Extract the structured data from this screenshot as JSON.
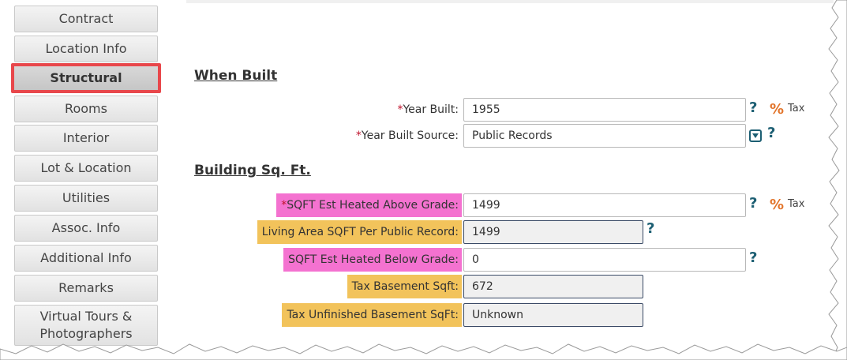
{
  "sidebar": {
    "items": [
      {
        "label": "Contract"
      },
      {
        "label": "Location Info"
      },
      {
        "label": "Structural",
        "active": true
      },
      {
        "label": "Rooms"
      },
      {
        "label": "Interior"
      },
      {
        "label": "Lot & Location"
      },
      {
        "label": "Utilities"
      },
      {
        "label": "Assoc. Info"
      },
      {
        "label": "Additional Info"
      },
      {
        "label": "Remarks"
      },
      {
        "label": "Virtual Tours & Photographers",
        "line1": "Virtual Tours &",
        "line2": "Photographers"
      }
    ]
  },
  "sections": {
    "when_built": "When Built",
    "building_sqft": "Building Sq. Ft."
  },
  "fields": {
    "year_built": {
      "required_mark": "*",
      "label": "Year Built:",
      "value": "1955"
    },
    "year_built_source": {
      "required_mark": "*",
      "label": "Year Built Source:",
      "value": "Public Records"
    },
    "sqft_above": {
      "required_mark": "*",
      "label": "SQFT Est Heated Above Grade:",
      "value": "1499"
    },
    "living_area": {
      "label": "Living Area SQFT Per Public Record:",
      "value": "1499"
    },
    "sqft_below": {
      "label": "SQFT Est Heated Below Grade:",
      "value": "0"
    },
    "tax_basement": {
      "label": "Tax Basement Sqft:",
      "value": "672"
    },
    "tax_unfinished": {
      "label": "Tax Unfinished Basement SqFt:",
      "value": "Unknown"
    }
  },
  "icons": {
    "help": "?",
    "percent": "%",
    "tax_link": "Tax"
  },
  "colors": {
    "active_border": "#e8474b",
    "required_highlight": "#f472d0",
    "public_record_highlight": "#f2c35b",
    "help_icon": "#1d5f73",
    "percent_icon": "#e2742a",
    "required_star": "#c0142e"
  }
}
